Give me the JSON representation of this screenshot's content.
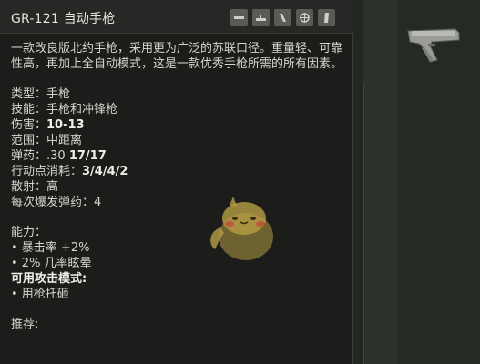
{
  "tooltip": {
    "title": "GR-121 自动手枪",
    "slot_icons": [
      "barrel-slot-icon",
      "sight-slot-icon",
      "magazine-slot-icon",
      "scope-slot-icon",
      "grip-slot-icon"
    ],
    "description": "一款改良版北约手枪，采用更为广泛的苏联口径。重量轻、可靠性高，再加上全自动模式，这是一款优秀手枪所需的所有因素。",
    "stats": [
      {
        "label": "类型：",
        "value": "手枪",
        "bold": false
      },
      {
        "label": "技能：",
        "value": "手枪和冲锋枪",
        "bold": false
      },
      {
        "label": "伤害：",
        "value": "10-13",
        "bold": true
      },
      {
        "label": "范围：",
        "value": "中距离",
        "bold": false
      },
      {
        "label": "弹药：",
        "value": ".30 ",
        "value2": "17/17",
        "bold": false
      },
      {
        "label": "行动点消耗：",
        "value": "3/4/4/2",
        "bold": true
      },
      {
        "label": "散射：",
        "value": "高",
        "bold": false
      },
      {
        "label": "每次爆发弹药：",
        "value": "4",
        "bold": false
      }
    ],
    "abilities_heading": "能力：",
    "abilities": [
      "• 暴击率 +2%",
      "• 2% 几率眩晕"
    ],
    "attack_modes_heading": "可用攻击模式:",
    "attack_modes": [
      "• 用枪托砸"
    ],
    "recommend_heading": "推荐:"
  },
  "colors": {
    "panel": "#1c1d1b",
    "header": "#272825",
    "text": "#d6d4cc"
  }
}
